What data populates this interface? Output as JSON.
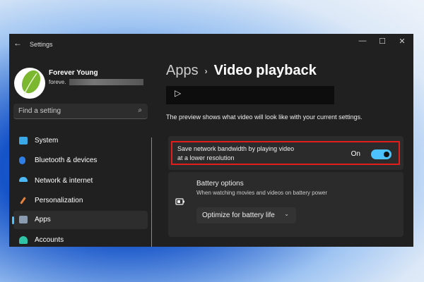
{
  "window": {
    "title": "Settings",
    "back_icon": "←",
    "minimize": "—",
    "maximize": "☐",
    "close": "✕"
  },
  "user": {
    "name": "Forever Young",
    "email": "foreve."
  },
  "search": {
    "placeholder": "Find a setting",
    "icon": "⌕"
  },
  "nav": [
    {
      "label": "System",
      "color": "#3aa7e6"
    },
    {
      "label": "Bluetooth & devices",
      "color": "#2f7fe8"
    },
    {
      "label": "Network & internet",
      "color": "#4cb8f5"
    },
    {
      "label": "Personalization",
      "color": "#e8823a"
    },
    {
      "label": "Apps",
      "color": "#8a9bb0",
      "selected": true
    },
    {
      "label": "Accounts",
      "color": "#2fc4a8"
    }
  ],
  "breadcrumb": {
    "parent": "Apps",
    "separator": "›",
    "current": "Video playback"
  },
  "preview": {
    "play_icon": "▷"
  },
  "description": "The preview shows what video will look like with your current settings.",
  "bandwidth": {
    "label_line1": "Save network bandwidth by playing video",
    "label_line2": "at a lower resolution",
    "state": "On",
    "enabled": true
  },
  "battery": {
    "title": "Battery options",
    "subtitle": "When watching movies and videos on battery power",
    "icon": "🔋",
    "selected": "Optimize for battery life",
    "chevron": "⌄"
  }
}
